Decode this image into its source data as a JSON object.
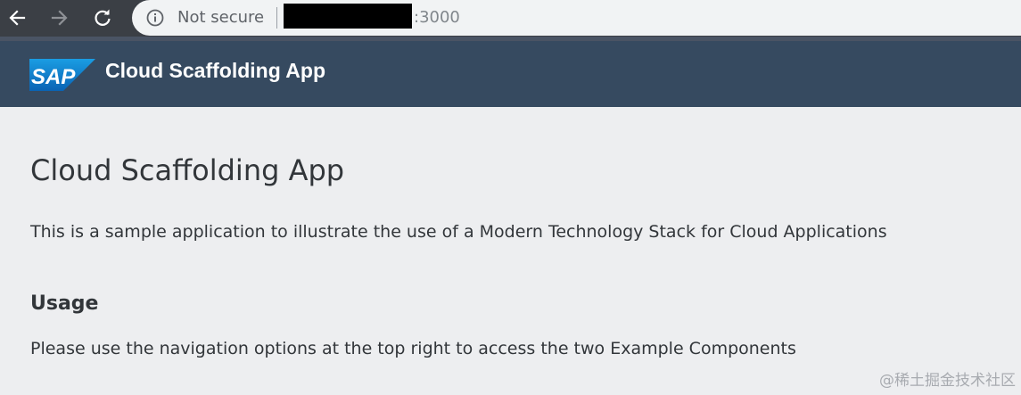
{
  "browser": {
    "security_label": "Not secure",
    "port": ":3000",
    "icons": {
      "back": "back-arrow-icon",
      "forward": "forward-arrow-icon",
      "reload": "reload-icon",
      "info": "info-icon"
    }
  },
  "shell": {
    "logo_text": "SAP",
    "app_title": "Cloud Scaffolding App",
    "header_color": "#364a60"
  },
  "main": {
    "title": "Cloud Scaffolding App",
    "intro": "This is a sample application to illustrate the use of a Modern Technology Stack for Cloud Applications",
    "usage_heading": "Usage",
    "usage_text": "Please use the navigation options at the top right to access the two Example Components"
  },
  "watermark": "@稀土掘金技术社区"
}
